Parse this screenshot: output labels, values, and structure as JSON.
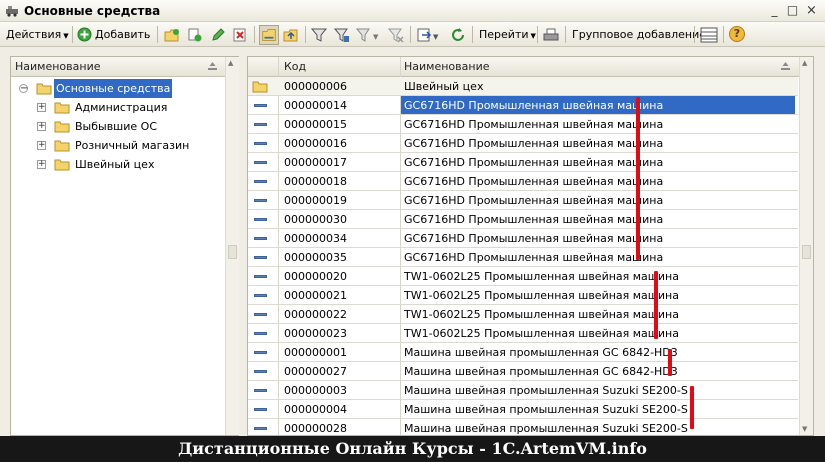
{
  "window": {
    "title": "Основные средства",
    "minimize_glyph": "_",
    "maximize_glyph": "□",
    "close_glyph": "×"
  },
  "toolbar": {
    "actions_label": "Действия",
    "add_label": "Добавить",
    "goto_label": "Перейти",
    "group_add_label": "Групповое добавление",
    "help_glyph": "?"
  },
  "tree": {
    "header": "Наименование",
    "root": "Основные средства",
    "items": [
      {
        "label": "Администрация"
      },
      {
        "label": "Выбывшие ОС"
      },
      {
        "label": "Розничный магазин"
      },
      {
        "label": "Швейный цех"
      }
    ]
  },
  "table": {
    "columns": {
      "code": "Код",
      "name": "Наименование"
    },
    "rows": [
      {
        "code": "000000006",
        "name": "Швейный цех",
        "type": "folder"
      },
      {
        "code": "000000014",
        "name": "GC6716HD Промышленная швейная машина",
        "type": "item",
        "selected": true
      },
      {
        "code": "000000015",
        "name": "GC6716HD Промышленная швейная машина",
        "type": "item"
      },
      {
        "code": "000000016",
        "name": "GC6716HD Промышленная швейная машина",
        "type": "item"
      },
      {
        "code": "000000017",
        "name": "GC6716HD Промышленная швейная машина",
        "type": "item"
      },
      {
        "code": "000000018",
        "name": "GC6716HD Промышленная швейная машина",
        "type": "item"
      },
      {
        "code": "000000019",
        "name": "GC6716HD Промышленная швейная машина",
        "type": "item"
      },
      {
        "code": "000000030",
        "name": "GC6716HD Промышленная швейная машина",
        "type": "item"
      },
      {
        "code": "000000034",
        "name": "GC6716HD Промышленная швейная машина",
        "type": "item"
      },
      {
        "code": "000000035",
        "name": "GC6716HD Промышленная швейная машина",
        "type": "item"
      },
      {
        "code": "000000020",
        "name": "TW1-0602L25 Промышленная швейная машина",
        "type": "item"
      },
      {
        "code": "000000021",
        "name": "TW1-0602L25 Промышленная швейная машина",
        "type": "item"
      },
      {
        "code": "000000022",
        "name": "TW1-0602L25 Промышленная швейная машина",
        "type": "item"
      },
      {
        "code": "000000023",
        "name": "TW1-0602L25 Промышленная швейная машина",
        "type": "item"
      },
      {
        "code": "000000001",
        "name": "Машина швейная промышленная GC 6842-HD3",
        "type": "item"
      },
      {
        "code": "000000027",
        "name": "Машина швейная промышленная GC 6842-HD3",
        "type": "item"
      },
      {
        "code": "000000003",
        "name": "Машина швейная промышленная Suzuki SE200-S",
        "type": "item"
      },
      {
        "code": "000000004",
        "name": "Машина швейная промышленная Suzuki SE200-S",
        "type": "item"
      },
      {
        "code": "000000028",
        "name": "Машина швейная промышленная Suzuki SE200-S",
        "type": "item"
      }
    ]
  },
  "banner": {
    "text": "Дистанционные Онлайн Курсы - 1C.ArtemVM.info"
  },
  "colors": {
    "selection": "#316ac5",
    "marker": "#e10b16",
    "banner_bg": "#171717"
  }
}
